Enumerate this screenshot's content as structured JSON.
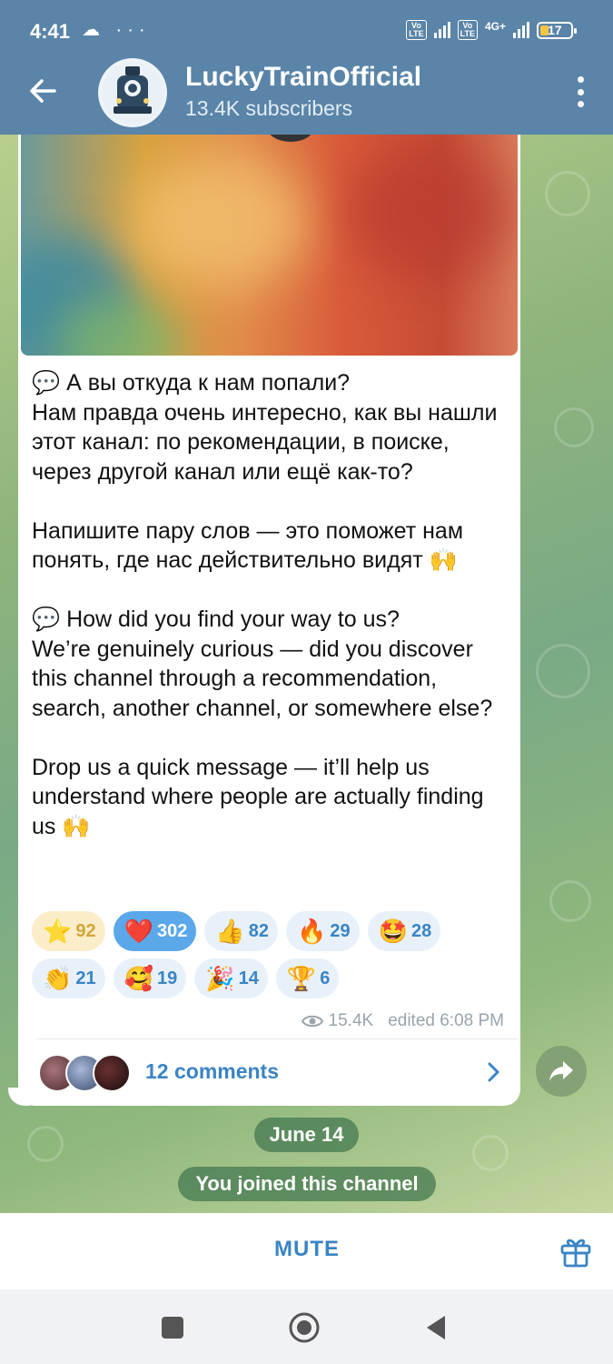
{
  "status_bar": {
    "time": "4:41",
    "notif_icons": "☁ ···",
    "net_label_1": "Vo LTE",
    "net_label_2": "Vo LTE",
    "net_type": "4G+",
    "battery": "17"
  },
  "header": {
    "title": "LuckyTrainOfficial",
    "subtitle": "13.4K subscribers",
    "back_icon": "arrow-left-icon",
    "menu_icon": "more-vertical-icon"
  },
  "message": {
    "text": "💬 А вы откуда к нам попали?\nНам правда очень интересно, как вы нашли этот канал: по рекомендации, в поиске, через другой канал или ещё как-то?\n\nНапишите пару слов — это поможет нам понять, где нас действительно видят 🙌\n\n💬 How did you find your way to us?\nWe’re genuinely curious — did you discover this channel through a recommendation, search, another channel, or somewhere else?\n\nDrop us a quick message — it’ll help us understand where people are actually finding us 🙌",
    "reactions": [
      {
        "emoji": "⭐",
        "count": "92"
      },
      {
        "emoji": "❤️",
        "count": "302"
      },
      {
        "emoji": "👍",
        "count": "82"
      },
      {
        "emoji": "🔥",
        "count": "29"
      },
      {
        "emoji": "🤩",
        "count": "28"
      },
      {
        "emoji": "👏",
        "count": "21"
      },
      {
        "emoji": "🥰",
        "count": "19"
      },
      {
        "emoji": "🎉",
        "count": "14"
      },
      {
        "emoji": "🏆",
        "count": "6"
      }
    ],
    "views": "15.4K",
    "edited": "edited 6:08 PM",
    "comments_label": "12 comments"
  },
  "service": {
    "date": "June 14",
    "joined": "You joined this channel"
  },
  "bottom_bar": {
    "mute_label": "MUTE"
  },
  "colors": {
    "header_bg": "#5a84a8",
    "accent": "#3a84c4",
    "chosen_reaction": "#5aa8ea"
  }
}
